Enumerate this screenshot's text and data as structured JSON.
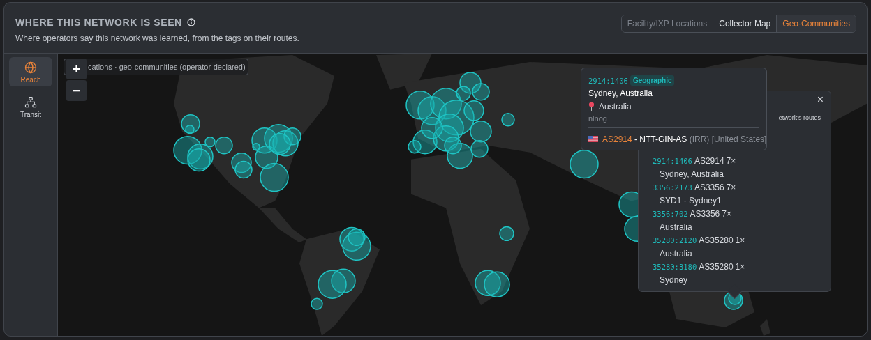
{
  "header": {
    "title": "WHERE THIS NETWORK IS SEEN",
    "subtitle": "Where operators say this network was learned, from the tags on their routes."
  },
  "view_switch": [
    {
      "label": "Facility/IXP Locations",
      "selected": false,
      "disabled": true
    },
    {
      "label": "Collector Map",
      "selected": false,
      "disabled": false
    },
    {
      "label": "Geo-Communities",
      "selected": true,
      "disabled": false
    }
  ],
  "sidebar": {
    "items": [
      {
        "label": "Reach",
        "kind": "globe",
        "selected": true
      },
      {
        "label": "Transit",
        "kind": "hierarchy",
        "selected": false
      }
    ]
  },
  "map": {
    "legend": "cations · geo-communities (operator-declared)",
    "zoom_controls": [
      "+",
      "−"
    ],
    "detail_popup": {
      "partial_text": "etwork's routes",
      "close": "×",
      "entries": [
        {
          "community": "2914:1406",
          "asn": "AS2914",
          "count": "7×",
          "location": "Sydney, Australia"
        },
        {
          "community": "3356:2173",
          "asn": "AS3356",
          "count": "7×",
          "location": "SYD1 - Sydney1"
        },
        {
          "community": "3356:702",
          "asn": "AS3356",
          "count": "7×",
          "location": "Australia"
        },
        {
          "community": "35280:2120",
          "asn": "AS35280",
          "count": "1×",
          "location": "Australia"
        },
        {
          "community": "35280:3180",
          "asn": "AS35280",
          "count": "1×",
          "location": "Sydney"
        }
      ]
    },
    "hover_tooltip": {
      "community": "2914:1406",
      "tag": "Geographic",
      "title": "Sydney, Australia",
      "country": "Australia",
      "source": "nlnog",
      "asn": "AS2914",
      "as_name": " - NTT-GIN-AS",
      "as_note": " (IRR) [United States]"
    }
  }
}
